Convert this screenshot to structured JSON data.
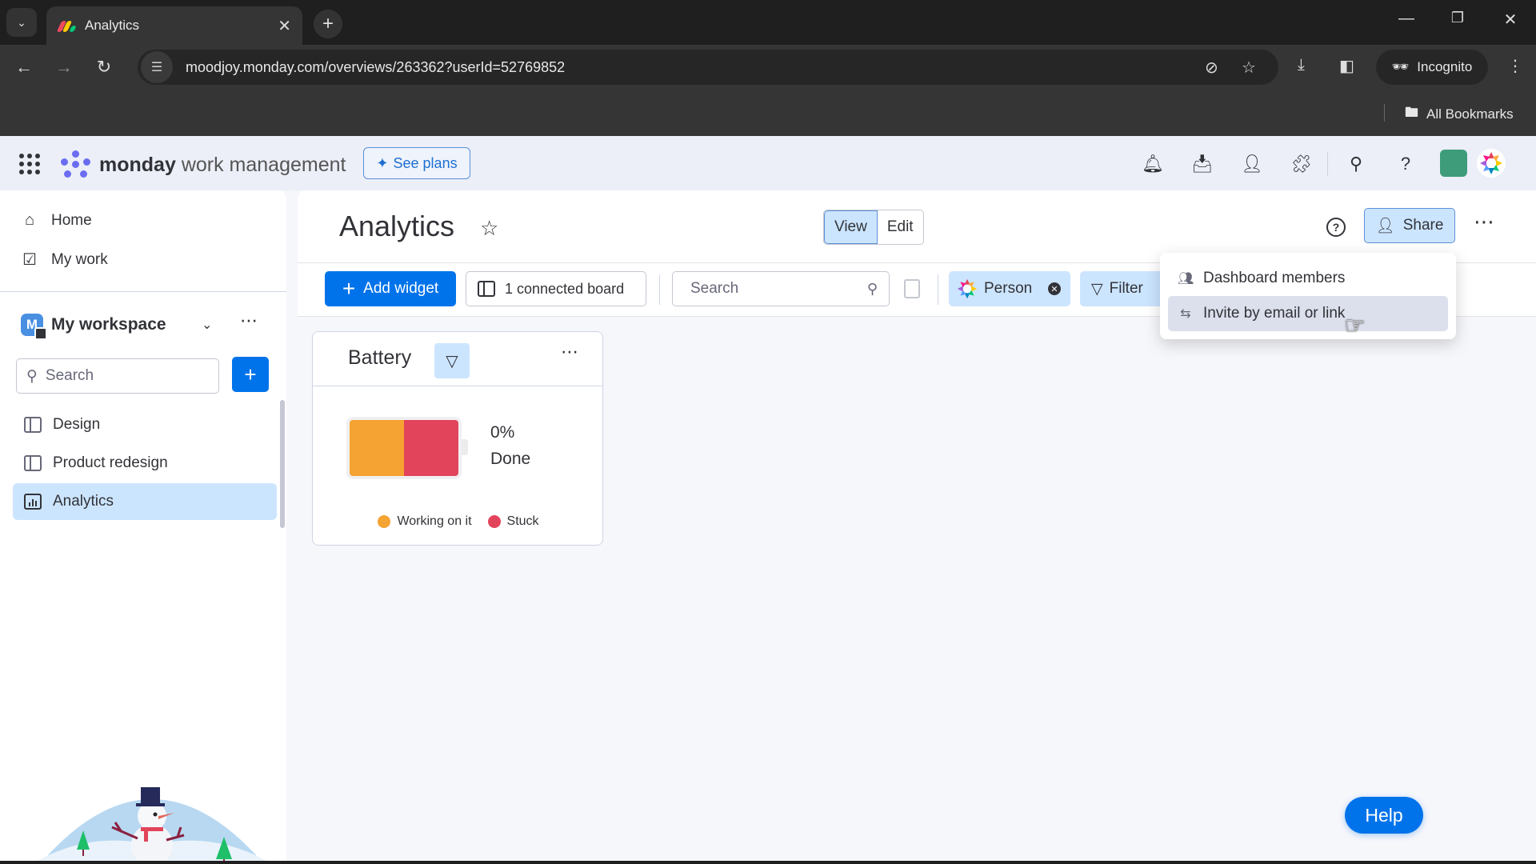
{
  "browser": {
    "tab_title": "Analytics",
    "url": "moodjoy.monday.com/overviews/263362?userId=52769852",
    "incognito_label": "Incognito",
    "bookmarks_label": "All Bookmarks"
  },
  "app": {
    "logo_bold": "monday",
    "logo_light": "work management",
    "see_plans": "See plans"
  },
  "sidebar": {
    "nav": [
      {
        "label": "Home",
        "icon": "home-icon"
      },
      {
        "label": "My work",
        "icon": "calendar-check-icon"
      }
    ],
    "workspace": {
      "initial": "M",
      "name": "My workspace"
    },
    "search_placeholder": "Search",
    "boards": [
      {
        "label": "Design",
        "icon": "board-icon",
        "active": false
      },
      {
        "label": "Product redesign",
        "icon": "board-icon",
        "active": false
      },
      {
        "label": "Analytics",
        "icon": "dashboard-icon",
        "active": true
      }
    ]
  },
  "main": {
    "title": "Analytics",
    "view_label": "View",
    "edit_label": "Edit",
    "share_label": "Share",
    "toolbar": {
      "add_widget": "Add widget",
      "connected_boards": "1 connected board",
      "search_placeholder": "Search",
      "person_filter": "Person",
      "filter_label": "Filter"
    },
    "widget": {
      "title": "Battery",
      "percent_done": "0%",
      "done_label": "Done",
      "segments": [
        {
          "label": "Working on it",
          "share": 0.5,
          "color": "#f5a332"
        },
        {
          "label": "Stuck",
          "share": 0.5,
          "color": "#e2445c"
        }
      ]
    }
  },
  "share_menu": {
    "items": [
      {
        "label": "Dashboard members",
        "icon": "members-icon"
      },
      {
        "label": "Invite by email or link",
        "icon": "link-icon"
      }
    ]
  },
  "help_button": "Help"
}
